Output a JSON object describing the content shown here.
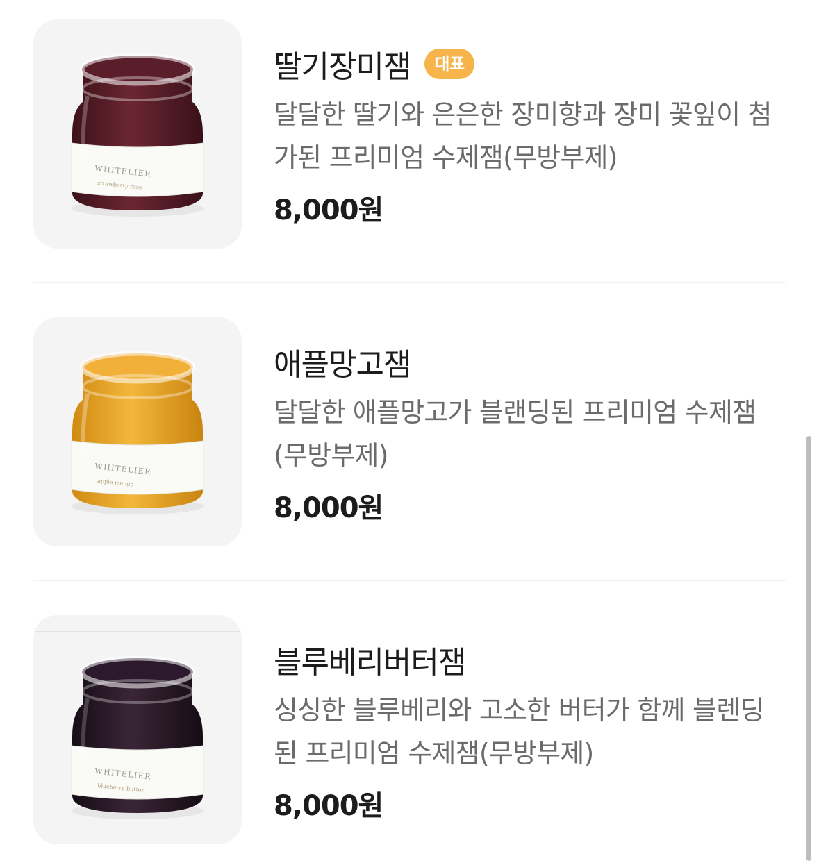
{
  "menu": {
    "items": [
      {
        "name": "딸기장미잼",
        "badge": "대표",
        "description": "달달한 딸기와 은은한 장미향과 장미 꽃잎이 첨가된 프리미엄 수제잼(무방부제)",
        "price": "8,000원",
        "image": {
          "jam_color": "#5a1d2a",
          "brand": "WHITELIER"
        }
      },
      {
        "name": "애플망고잼",
        "badge": "",
        "description": "달달한 애플망고가 블랜딩된 프리미엄 수제잼(무방부제)",
        "price": "8,000원",
        "image": {
          "jam_color": "#e8a622",
          "brand": "WHITELIER"
        }
      },
      {
        "name": "블루베리버터잼",
        "badge": "",
        "description": "싱싱한 블루베리와 고소한 버터가 함께 블렌딩된 프리미엄 수제잼(무방부제)",
        "price": "8,000원",
        "image": {
          "jam_color": "#2b1c2c",
          "brand": "WHITELIER"
        }
      }
    ]
  },
  "colors": {
    "badge": "#f6b44b",
    "description": "#6b6b6b",
    "title": "#1c1c1c",
    "thumb_bg": "#f4f4f4"
  }
}
